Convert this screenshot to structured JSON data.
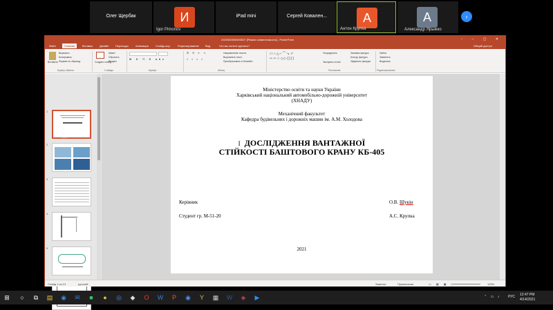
{
  "call": {
    "participants": [
      {
        "name": "Олег Щербак",
        "initial": ""
      },
      {
        "name": "Igor Pimonov",
        "initial": "И",
        "color": "#d9461e"
      },
      {
        "name": "iPad mini",
        "initial": ""
      },
      {
        "name": "Сергей  Ковален...",
        "initial": ""
      },
      {
        "name": "Антон Крупка",
        "initial": "А",
        "color": "#e8572b"
      },
      {
        "name": "Александр Ярыжко",
        "initial": "А",
        "color": "#6b7b8c"
      }
    ]
  },
  "ppt": {
    "window_title": "2020000000000007 [Режим совместимости] - PowerPoint",
    "tabs": [
      "Файл",
      "Главная",
      "Вставка",
      "Дизайн",
      "Переходы",
      "Анимация",
      "Слайд-шоу",
      "Рецензирование",
      "Вид",
      "Что вы хотите сделать?"
    ],
    "share": "Общий доступ",
    "ribbon": {
      "paste": "Вставить",
      "cut": "Вырезать",
      "copy": "Копировать",
      "format_painter": "Формат по образцу",
      "new_slide": "Создать слайд",
      "layout": "Макет",
      "reset": "Сбросить",
      "section": "Раздел",
      "text_direction": "Направление текста",
      "align_text": "Выровнять текст",
      "smartart": "Преобразовать в SmartArt",
      "arrange": "Упорядочить",
      "quick_styles": "Экспресс-стили",
      "shape_fill": "Заливка фигуры",
      "shape_outline": "Контур фигуры",
      "shape_effects": "Эффекты фигуры",
      "find": "Найти",
      "replace": "Заменить",
      "select": "Выделить",
      "groups": [
        "Буфер обмена",
        "Слайды",
        "Шрифт",
        "Абзац",
        "Рисование",
        "Редактирование"
      ]
    },
    "slide": {
      "ministry": "Міністерство освіти та науки України",
      "university": "Харківський національний автомобільно-дорожній університет",
      "abbr": "(ХНАДУ)",
      "faculty": "Механічний факультет",
      "department": "Кафедра будівельних і дорожніх машин ім. А.М. Холодова",
      "title_line1": "ДОСЛІДЖЕННЯ ВАНТАЖНОЇ",
      "title_line2": "СТІЙКОСТІ БАШТОВОГО КРАНУ КБ-405",
      "supervisor_label": "Керівник",
      "supervisor_name_prefix": "О.В. ",
      "supervisor_name_surname": "Шукін",
      "student_label": "Студент гр. М-51-20",
      "student_name": "А.С. Крупка",
      "year": "2021"
    },
    "thumb_numbers": [
      "1",
      "2",
      "3",
      "4",
      "5",
      "6"
    ],
    "status": {
      "slide_info": "Слайд 1 из 13",
      "language": "русский",
      "notes": "Заметки",
      "comments": "Примечания",
      "zoom": "125%"
    }
  },
  "taskbar": {
    "language": "РУС",
    "time": "12:47 PM",
    "date": "4/14/2021"
  }
}
